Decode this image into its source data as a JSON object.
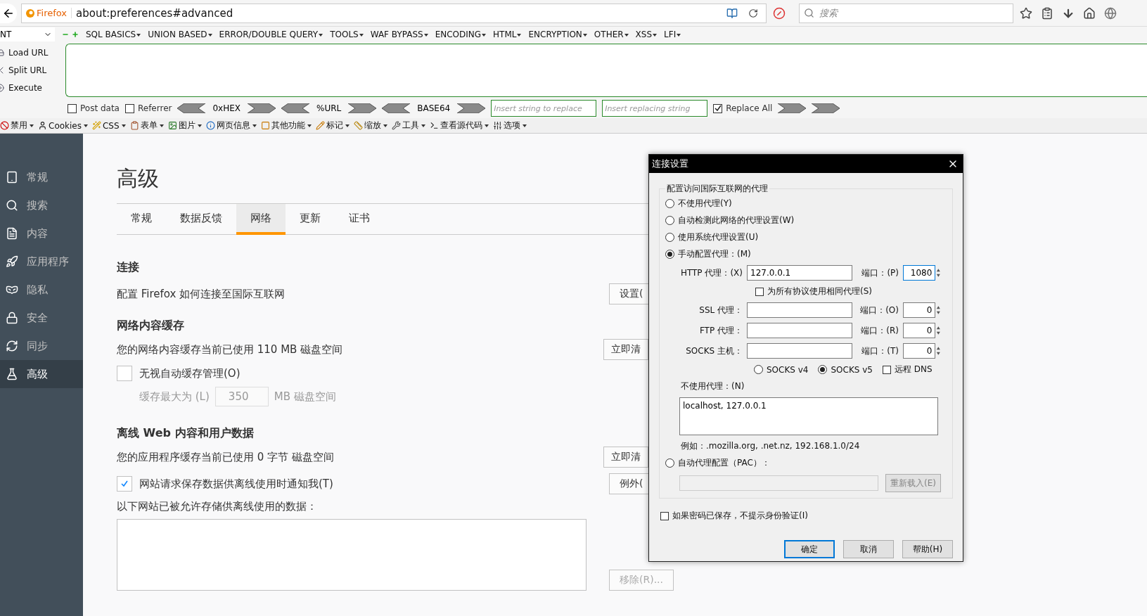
{
  "navbar": {
    "identity": "Firefox",
    "url": "about:preferences#advanced",
    "search_placeholder": "搜索"
  },
  "hackbar": {
    "select": "NT",
    "menus": [
      "SQL BASICS",
      "UNION BASED",
      "ERROR/DOUBLE QUERY",
      "TOOLS",
      "WAF BYPASS",
      "ENCODING",
      "HTML",
      "ENCRYPTION",
      "OTHER",
      "XSS",
      "LFI"
    ],
    "actions": [
      "Load URL",
      "Split URL",
      "Execute"
    ],
    "options": [
      {
        "label": "Post data",
        "checked": false
      },
      {
        "label": "Referrer",
        "checked": false
      }
    ],
    "encoders": [
      "0xHEX",
      "%URL",
      "BASE64"
    ],
    "replace_placeholders": [
      "Insert string to replace",
      "Insert replacing string"
    ],
    "replace_all": {
      "label": "Replace All",
      "checked": true
    }
  },
  "devbar": [
    "禁用",
    "Cookies",
    "CSS",
    "表单",
    "图片",
    "网页信息",
    "其他功能",
    "标记",
    "缩放",
    "工具",
    "查看源代码",
    "选项"
  ],
  "sidebar": [
    {
      "label": "常规",
      "selected": false
    },
    {
      "label": "搜索",
      "selected": false
    },
    {
      "label": "内容",
      "selected": false
    },
    {
      "label": "应用程序",
      "selected": false
    },
    {
      "label": "隐私",
      "selected": false
    },
    {
      "label": "安全",
      "selected": false
    },
    {
      "label": "同步",
      "selected": false
    },
    {
      "label": "高级",
      "selected": true
    }
  ],
  "page": {
    "title": "高级",
    "tabs": [
      {
        "label": "常规",
        "selected": false
      },
      {
        "label": "数据反馈",
        "selected": false
      },
      {
        "label": "网络",
        "selected": true
      },
      {
        "label": "更新",
        "selected": false
      },
      {
        "label": "证书",
        "selected": false
      }
    ],
    "connection": {
      "heading": "连接",
      "text": "配置 Firefox 如何连接至国际互联网",
      "button": "设置("
    },
    "cache": {
      "heading": "网络内容缓存",
      "text": "您的网络内容缓存当前已使用 110 MB 磁盘空间",
      "button": "立即清",
      "override": {
        "label": "无视自动缓存管理(O)",
        "checked": false
      },
      "limit_label": "缓存最大为 (L)",
      "limit_value": "350",
      "limit_unit": "MB 磁盘空间"
    },
    "offline": {
      "heading": "离线 Web 内容和用户数据",
      "text": "您的应用程序缓存当前已使用 0 字节 磁盘空间",
      "button": "立即清",
      "notify": {
        "label": "网站请求保存数据供离线使用时通知我(T)",
        "checked": true
      },
      "exceptions_button": "例外(",
      "list_label": "以下网站已被允许存储供离线使用的数据：",
      "remove_button": "移除(R)..."
    }
  },
  "dialog": {
    "title": "连接设置",
    "group": "配置访问国际互联网的代理",
    "modes": [
      {
        "kind": "simple",
        "label": "不使用代理(Y)",
        "selected": false
      },
      {
        "kind": "simple",
        "label": "自动检测此网络的代理设置(W)",
        "selected": false
      },
      {
        "kind": "simple",
        "label": "使用系统代理设置(U)",
        "selected": false
      },
      {
        "kind": "manual",
        "label": "手动配置代理：(M)",
        "selected": true
      },
      {
        "kind": "pac",
        "label": "自动代理配置（PAC）：",
        "selected": false
      }
    ],
    "proxies": [
      {
        "label": "HTTP 代理：(X)",
        "value": "127.0.0.1",
        "port_label": "端口：(P)",
        "port": "1080",
        "focused": true
      },
      {
        "label": "SSL 代理：",
        "port_label": "端口：(O)",
        "port": "0",
        "focused": false
      },
      {
        "label": "FTP 代理：",
        "port_label": "端口：(R)",
        "port": "0",
        "focused": false
      },
      {
        "label": "SOCKS 主机：",
        "port_label": "端口：(T)",
        "port": "0",
        "focused": false
      }
    ],
    "share": {
      "label": "为所有协议使用相同代理(S)",
      "checked": false
    },
    "socks_versions": [
      {
        "label": "SOCKS v4",
        "selected": false
      },
      {
        "label": "SOCKS v5",
        "selected": true
      }
    ],
    "remote_dns": {
      "label": "远程 DNS",
      "checked": false
    },
    "no_proxy_label": "不使用代理：(N)",
    "no_proxy": "localhost, 127.0.0.1",
    "example": "例如：.mozilla.org, .net.nz, 192.168.1.0/24",
    "reload": "重新载入(E)",
    "no_auth": {
      "label": "如果密码已保存，不提示身份验证(I)",
      "checked": false
    },
    "buttons": [
      {
        "label": "确定",
        "primary": true
      },
      {
        "label": "取消",
        "primary": false
      },
      {
        "label": "帮助(H)",
        "primary": false
      }
    ]
  }
}
